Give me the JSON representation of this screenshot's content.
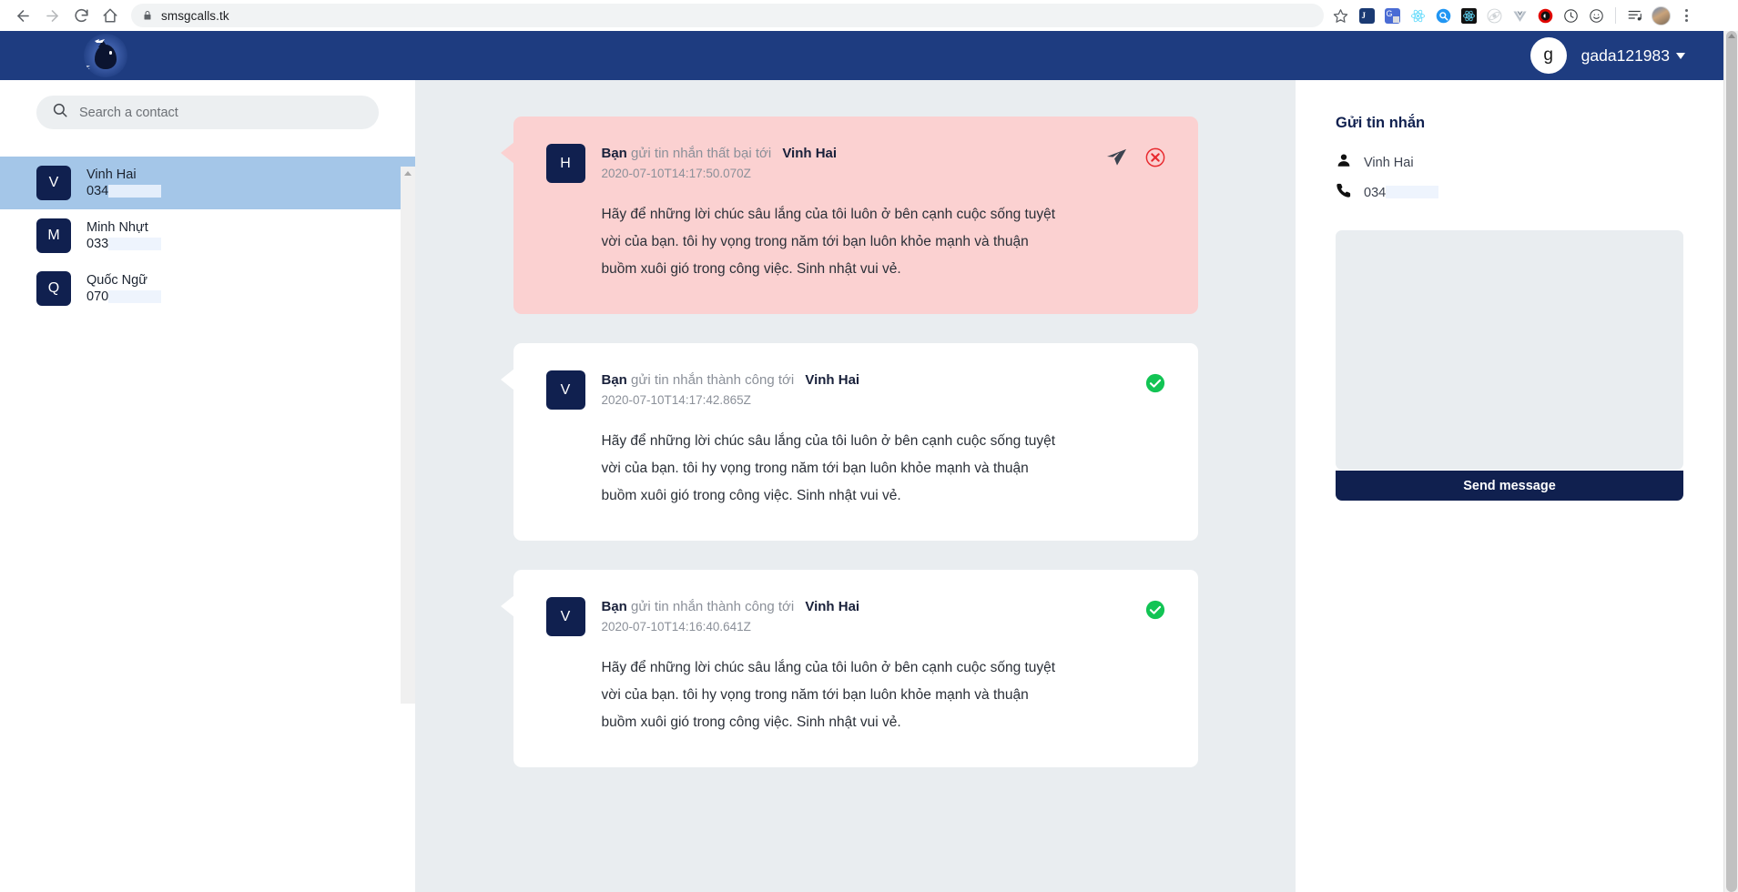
{
  "browser": {
    "url": "smsgcalls.tk",
    "back_icon": "back-arrow-icon",
    "forward_icon": "forward-arrow-icon",
    "reload_icon": "reload-icon",
    "home_icon": "home-icon",
    "lock_icon": "lock-icon",
    "bookmark_icon": "star-icon",
    "menu_icon": "kebab-menu-icon",
    "extensions": [
      "joplin-extension-icon",
      "google-translate-extension-icon",
      "react-devtools-extension-icon",
      "search-extension-icon",
      "react-native-extension-icon",
      "ionic-extension-icon",
      "vuejs-extension-icon",
      "adblock-extension-icon",
      "clock-extension-icon",
      "smiley-extension-icon",
      "reading-list-icon"
    ]
  },
  "header": {
    "logo_alt": "bird-logo",
    "user_initial": "g",
    "user_name": "gada121983",
    "brand_color": "#1e3c80"
  },
  "sidebar": {
    "search_placeholder": "Search a contact",
    "contacts": [
      {
        "initial": "V",
        "name": "Vinh Hai",
        "phone_prefix": "034",
        "active": true
      },
      {
        "initial": "M",
        "name": "Minh Nhựt",
        "phone_prefix": "033",
        "active": false
      },
      {
        "initial": "Q",
        "name": "Quốc Ngữ",
        "phone_prefix": "070",
        "active": false
      }
    ]
  },
  "chat": {
    "messages": [
      {
        "avatar_initial": "H",
        "status": "failed",
        "prefix": "Bạn",
        "label": "gửi tin nhắn thất bại tới",
        "recipient": "Vinh Hai",
        "timestamp": "2020-07-10T14:17:50.070Z",
        "body": "Hãy để những lời chúc sâu lắng của tôi luôn ở bên cạnh cuộc sống tuyệt vời của bạn. tôi hy vọng trong năm tới bạn luôn khỏe mạnh và thuận buồm xuôi gió trong công việc. Sinh nhật vui vẻ.",
        "resend_icon": "paper-plane-icon",
        "status_icon": "error-circle-icon"
      },
      {
        "avatar_initial": "V",
        "status": "success",
        "prefix": "Bạn",
        "label": "gửi tin nhắn thành công tới",
        "recipient": "Vinh Hai",
        "timestamp": "2020-07-10T14:17:42.865Z",
        "body": "Hãy để những lời chúc sâu lắng của tôi luôn ở bên cạnh cuộc sống tuyệt vời của bạn. tôi hy vọng trong năm tới bạn luôn khỏe mạnh và thuận buồm xuôi gió trong công việc. Sinh nhật vui vẻ.",
        "status_icon": "check-circle-icon"
      },
      {
        "avatar_initial": "V",
        "status": "success",
        "prefix": "Bạn",
        "label": "gửi tin nhắn thành công tới",
        "recipient": "Vinh Hai",
        "timestamp": "2020-07-10T14:16:40.641Z",
        "body": "Hãy để những lời chúc sâu lắng của tôi luôn ở bên cạnh cuộc sống tuyệt vời của bạn. tôi hy vọng trong năm tới bạn luôn khỏe mạnh và thuận buồm xuôi gió trong công việc. Sinh nhật vui vẻ.",
        "status_icon": "check-circle-icon"
      }
    ]
  },
  "compose": {
    "title": "Gửi tin nhắn",
    "contact_name": "Vinh Hai",
    "contact_phone_prefix": "034",
    "person_icon": "person-icon",
    "phone_icon": "phone-icon",
    "textarea_value": "",
    "textarea_placeholder": "",
    "send_label": "Send message",
    "send_color": "#10204f"
  }
}
